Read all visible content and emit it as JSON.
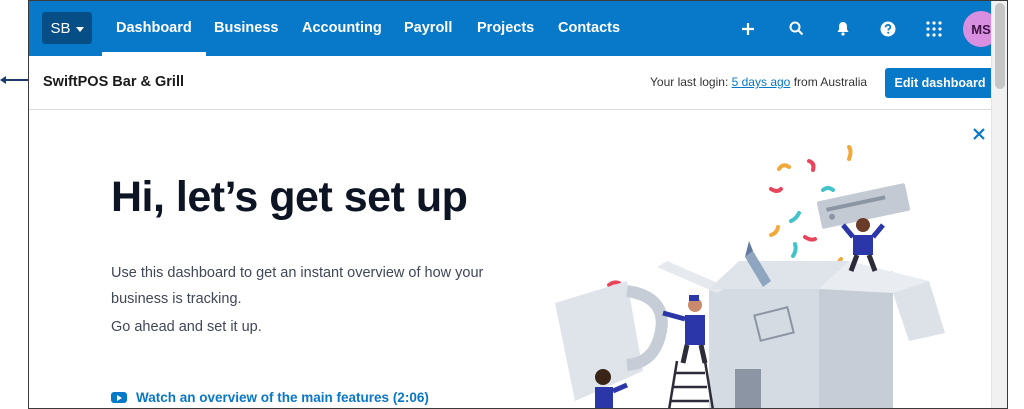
{
  "nav": {
    "org_short": "SB",
    "items": [
      {
        "label": "Dashboard",
        "active": true
      },
      {
        "label": "Business",
        "active": false
      },
      {
        "label": "Accounting",
        "active": false
      },
      {
        "label": "Payroll",
        "active": false
      },
      {
        "label": "Projects",
        "active": false
      },
      {
        "label": "Contacts",
        "active": false
      }
    ],
    "icons": [
      "plus-icon",
      "search-icon",
      "bell-icon",
      "help-icon",
      "apps-grid-icon"
    ],
    "avatar_initials": "MS"
  },
  "header": {
    "org_name": "SwiftPOS Bar & Grill",
    "last_login_prefix": "Your last login:",
    "last_login_link": "5 days ago",
    "last_login_suffix": "from Australia",
    "edit_button": "Edit dashboard"
  },
  "setup": {
    "title": "Hi, let’s get set up",
    "description": "Use this dashboard to get an instant overview of how your business is tracking.",
    "description2": "Go ahead and set it up.",
    "video_link": "Watch an overview of the main features (2:06)"
  },
  "colors": {
    "brand": "#0878c9",
    "brand_dark": "#064f86",
    "avatar": "#d98fe0"
  }
}
